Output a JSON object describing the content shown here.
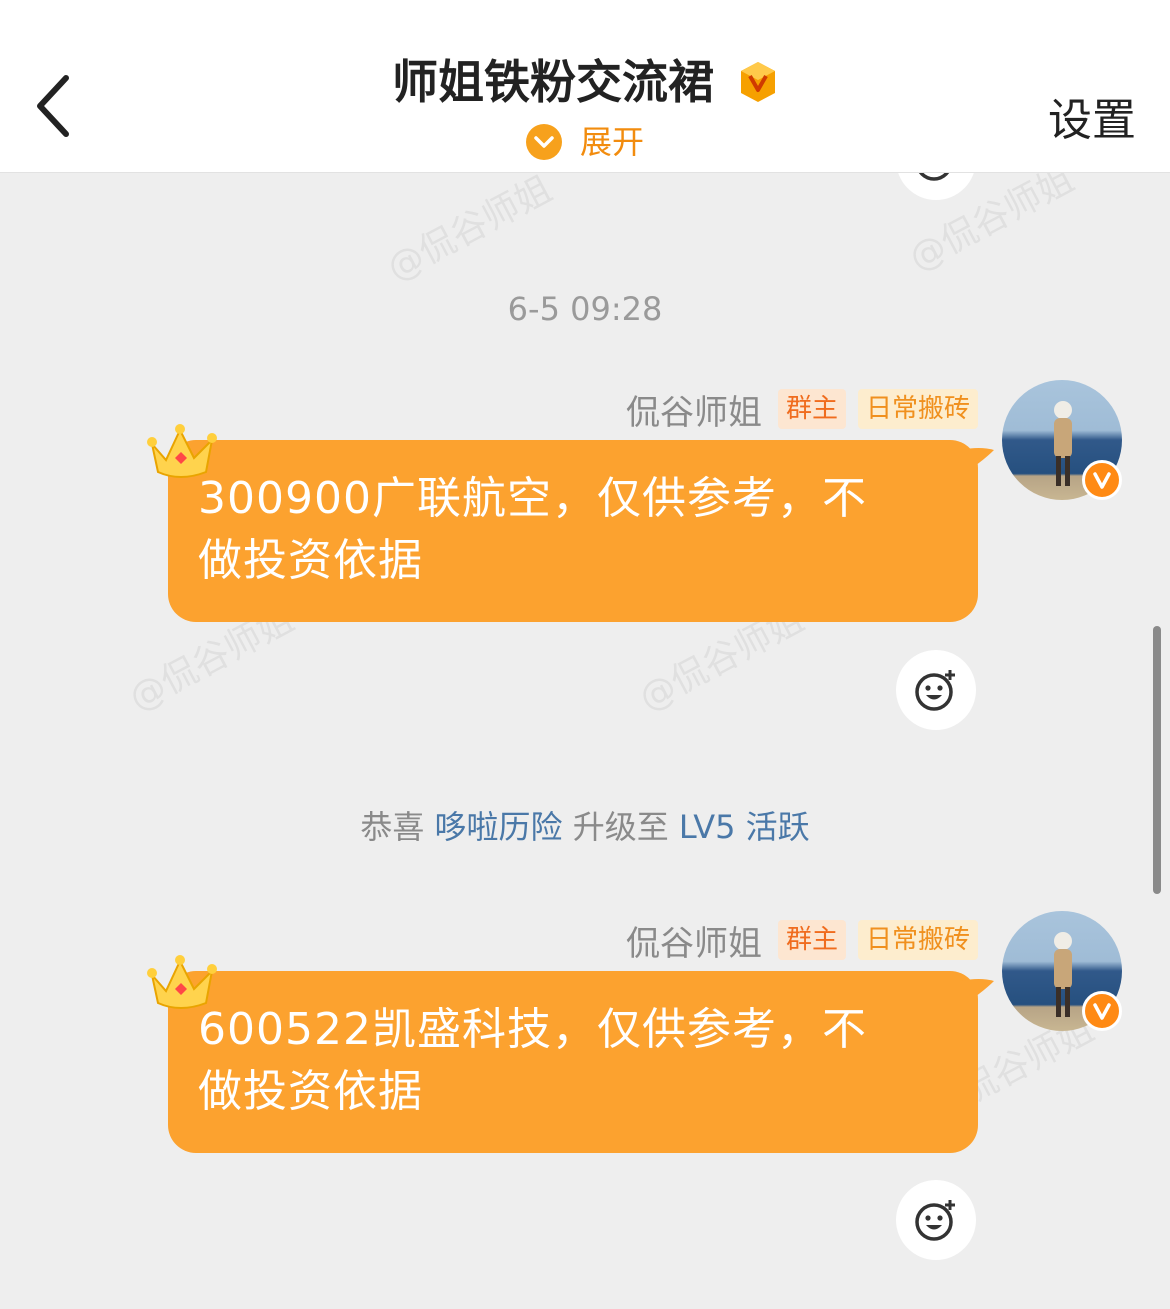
{
  "header": {
    "title": "师姐铁粉交流裙",
    "expand_label": "展开",
    "settings_label": "设置"
  },
  "watermark_text": "@侃谷师姐",
  "timestamp": "6-5 09:28",
  "system_message": {
    "prefix": "恭喜 ",
    "user": "哆啦历险",
    "middle": " 升级至 ",
    "level": "LV5 活跃"
  },
  "messages": [
    {
      "sender": "侃谷师姐",
      "tag_role": "群主",
      "tag_title": "日常搬砖",
      "line1": "300900广联航空，仅供参考，不",
      "line2": "做投资依据"
    },
    {
      "sender": "侃谷师姐",
      "tag_role": "群主",
      "tag_title": "日常搬砖",
      "line1": "600522凯盛科技，仅供参考，不",
      "line2": "做投资依据"
    }
  ],
  "colors": {
    "bubble": "#fca22f",
    "accent": "#f28c0e",
    "link": "#4a78a8"
  },
  "icons": [
    "back-arrow-icon",
    "vip-badge-icon",
    "chevron-down-icon",
    "crown-icon",
    "verified-v-icon",
    "add-reaction-icon"
  ]
}
